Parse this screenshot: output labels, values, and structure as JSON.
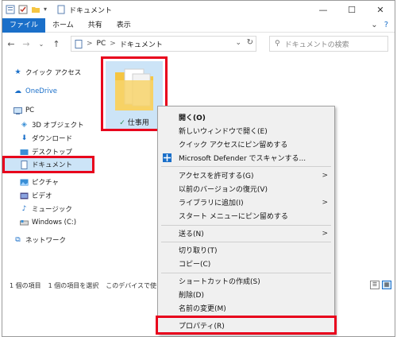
{
  "window": {
    "title": "ドキュメント",
    "controls": {
      "minimize": "—",
      "maximize": "☐",
      "close": "✕"
    }
  },
  "ribbon": {
    "tabs": [
      {
        "label": "ファイル",
        "active": true
      },
      {
        "label": "ホーム"
      },
      {
        "label": "共有"
      },
      {
        "label": "表示"
      }
    ],
    "expand": "⌄",
    "help": "?"
  },
  "address": {
    "back": "←",
    "forward": "→",
    "recent": "⌄",
    "up": "↑",
    "path": [
      "PC",
      "ドキュメント"
    ],
    "path_sep": ">",
    "search_placeholder": "ドキュメントの検索"
  },
  "sidebar": {
    "items": [
      {
        "label": "クイック アクセス",
        "icon": "star-icon"
      },
      {
        "label": "OneDrive",
        "icon": "cloud-icon"
      },
      {
        "label": "PC",
        "icon": "pc-icon"
      },
      {
        "label": "3D オブジェクト",
        "icon": "cube-icon"
      },
      {
        "label": "ダウンロード",
        "icon": "download-icon"
      },
      {
        "label": "デスクトップ",
        "icon": "desktop-folder-icon"
      },
      {
        "label": "ドキュメント",
        "icon": "documents-icon",
        "selected": true
      },
      {
        "label": "ピクチャ",
        "icon": "pictures-icon"
      },
      {
        "label": "ビデオ",
        "icon": "video-icon"
      },
      {
        "label": "ミュージック",
        "icon": "music-icon"
      },
      {
        "label": "Windows (C:)",
        "icon": "drive-icon"
      },
      {
        "label": "ネットワーク",
        "icon": "network-icon"
      }
    ]
  },
  "folder": {
    "name": "仕事用",
    "sync_icon": "✓"
  },
  "status": {
    "items": "1 個の項目",
    "selected": "1 個の項目を選択",
    "device": "このデバイスで使"
  },
  "context_menu": {
    "items": [
      "開く(O)",
      "新しいウィンドウで開く(E)",
      "クイック アクセスにピン留めする",
      "Microsoft Defender でスキャンする...",
      "アクセスを許可する(G)",
      "以前のバージョンの復元(V)",
      "ライブラリに追加(I)",
      "スタート メニューにピン留めする",
      "送る(N)",
      "切り取り(T)",
      "コピー(C)",
      "ショートカットの作成(S)",
      "削除(D)",
      "名前の変更(M)",
      "プロパティ(R)"
    ],
    "submenu_arrow": ">"
  },
  "colors": {
    "accent": "#1a6fc9",
    "highlight_box": "#e8001c",
    "selection": "#cce4f7",
    "menu_bg": "#f0f0f0"
  }
}
